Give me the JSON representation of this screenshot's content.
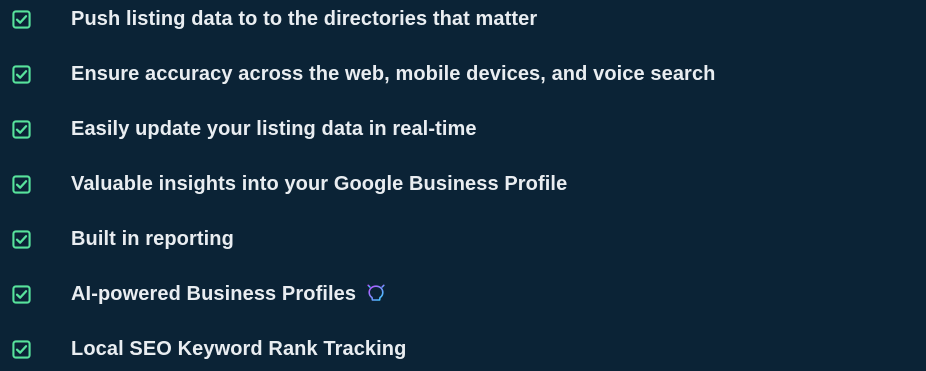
{
  "colors": {
    "background": "#0b2336",
    "text": "#e9edf1",
    "checkbox_green": "#58e39c",
    "bulb_gradient": [
      "#c04cff",
      "#38d0ff"
    ]
  },
  "features": [
    {
      "label": "Push listing data to to the directories that matter",
      "icon": "check-icon"
    },
    {
      "label": "Ensure accuracy across the web, mobile devices, and voice search",
      "icon": "check-icon"
    },
    {
      "label": "Easily update your listing data in real-time",
      "icon": "check-icon"
    },
    {
      "label": "Valuable insights into your Google Business Profile",
      "icon": "check-icon"
    },
    {
      "label": "Built in reporting",
      "icon": "check-icon"
    },
    {
      "label": "AI-powered Business Profiles",
      "icon": "check-icon",
      "badge_icon": "lightbulb-icon"
    },
    {
      "label": "Local SEO Keyword Rank Tracking",
      "icon": "check-icon"
    }
  ]
}
